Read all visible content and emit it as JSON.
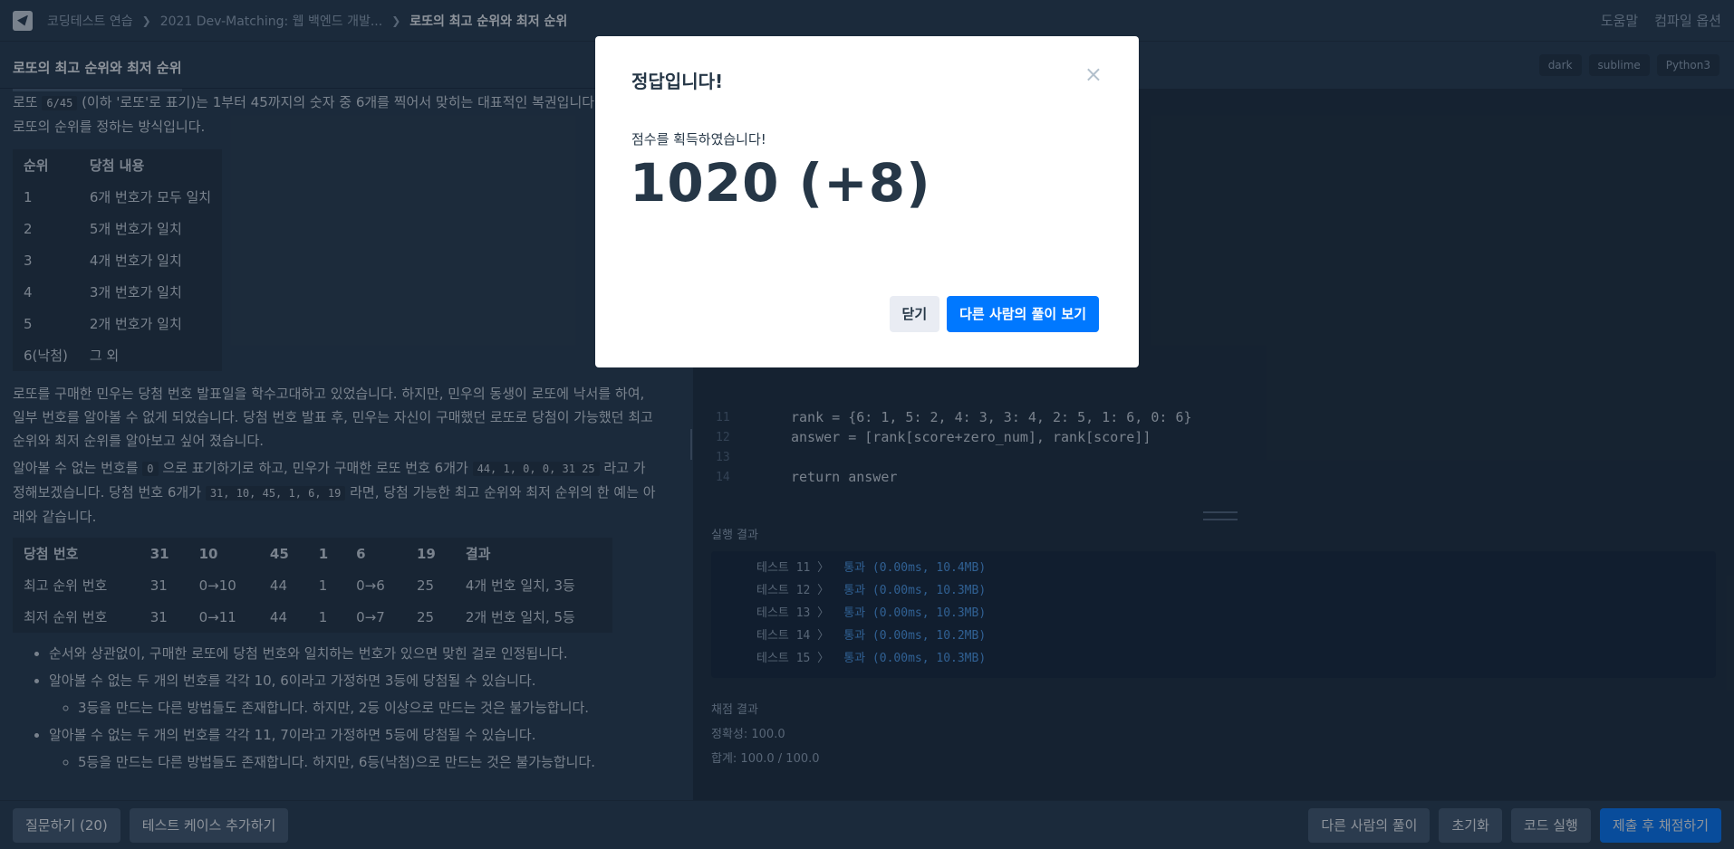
{
  "breadcrumb": {
    "items": [
      "코딩테스트 연습",
      "2021 Dev-Matching: 웹 백엔드 개발...",
      "로또의 최고 순위와 최저 순위"
    ]
  },
  "nav": {
    "help": "도움말",
    "compile_options": "컴파일 옵션"
  },
  "problem": {
    "title": "로또의 최고 순위와 최저 순위",
    "intro_a": "로또",
    "intro_code": "6/45",
    "intro_b": "(이하 '로또'로 표기)는 1부터 45까지의 숫자 중 6개를 찍어서 맞히는 대표적인 복권입니다. 아래는 로또의 순위를 정하는 방식입니다.",
    "rank_table": {
      "headers": [
        "순위",
        "당첨 내용"
      ],
      "rows": [
        [
          "1",
          "6개 번호가 모두 일치"
        ],
        [
          "2",
          "5개 번호가 일치"
        ],
        [
          "3",
          "4개 번호가 일치"
        ],
        [
          "4",
          "3개 번호가 일치"
        ],
        [
          "5",
          "2개 번호가 일치"
        ],
        [
          "6(낙첨)",
          "그 외"
        ]
      ]
    },
    "para2": "로또를 구매한 민우는 당첨 번호 발표일을 학수고대하고 있었습니다. 하지만, 민우의 동생이 로또에 낙서를 하여, 일부 번호를 알아볼 수 없게 되었습니다. 당첨 번호 발표 후, 민우는 자신이 구매했던 로또로 당첨이 가능했던 최고 순위와 최저 순위를 알아보고 싶어 졌습니다.",
    "para3_a": "알아볼 수 없는 번호를",
    "para3_code1": "0",
    "para3_b": "으로 표기하기로 하고, 민우가 구매한 로또 번호 6개가",
    "para3_code2": "44, 1, 0, 0, 31 25",
    "para3_c": "라고 가정해보겠습니다. 당첨 번호 6개가",
    "para3_code3": "31, 10, 45, 1, 6, 19",
    "para3_d": "라면, 당첨 가능한 최고 순위와 최저 순위의 한 예는 아래와 같습니다.",
    "win_table": {
      "headers": [
        "당첨 번호",
        "31",
        "10",
        "45",
        "1",
        "6",
        "19",
        "결과"
      ],
      "rows": [
        [
          "최고 순위 번호",
          "31",
          "0→10",
          "44",
          "1",
          "0→6",
          "25",
          "4개 번호 일치, 3등"
        ],
        [
          "최저 순위 번호",
          "31",
          "0→11",
          "44",
          "1",
          "0→7",
          "25",
          "2개 번호 일치, 5등"
        ]
      ]
    },
    "notes": [
      "순서와 상관없이, 구매한 로또에 당첨 번호와 일치하는 번호가 있으면 맞힌 걸로 인정됩니다.",
      "알아볼 수 없는 두 개의 번호를 각각 10, 6이라고 가정하면 3등에 당첨될 수 있습니다.",
      "3등을 만드는 다른 방법들도 존재합니다. 하지만, 2등 이상으로 만드는 것은 불가능합니다.",
      "알아볼 수 없는 두 개의 번호를 각각 11, 7이라고 가정하면 5등에 당첨될 수 있습니다.",
      "5등을 만드는 다른 방법들도 존재합니다. 하지만, 6등(낙첨)으로 만드는 것은 불가능합니다."
    ]
  },
  "editor": {
    "theme_dark": "dark",
    "keymap": "sublime",
    "language": "Python3",
    "code_lines": [
      "rank = {6: 1, 5: 2, 4: 3, 3: 4, 2: 5, 1: 6, 0: 6}",
      "answer = [rank[score+zero_num], rank[score]]",
      "",
      "return answer"
    ],
    "line_numbers": [
      "11",
      "12",
      "13",
      "14"
    ]
  },
  "results": {
    "title": "실행 결과",
    "cases": [
      {
        "label": "테스트 11 〉",
        "result": "통과 (0.00ms, 10.4MB)"
      },
      {
        "label": "테스트 12 〉",
        "result": "통과 (0.00ms, 10.3MB)"
      },
      {
        "label": "테스트 13 〉",
        "result": "통과 (0.00ms, 10.3MB)"
      },
      {
        "label": "테스트 14 〉",
        "result": "통과 (0.00ms, 10.2MB)"
      },
      {
        "label": "테스트 15 〉",
        "result": "통과 (0.00ms, 10.3MB)"
      }
    ],
    "summary_title": "채점 결과",
    "accuracy": "정확성: 100.0",
    "total": "합계: 100.0 / 100.0"
  },
  "bottom": {
    "ask": "질문하기 (20)",
    "add_testcase": "테스트 케이스 추가하기",
    "others": "다른 사람의 풀이",
    "reset": "초기화",
    "run": "코드 실행",
    "submit": "제출 후 채점하기"
  },
  "modal": {
    "title": "정답입니다!",
    "close_glyph": "×",
    "subtitle": "점수를 획득하였습니다!",
    "score": "1020 (+8)",
    "close_button": "닫기",
    "view_others_button": "다른 사람의 풀이 보기"
  }
}
